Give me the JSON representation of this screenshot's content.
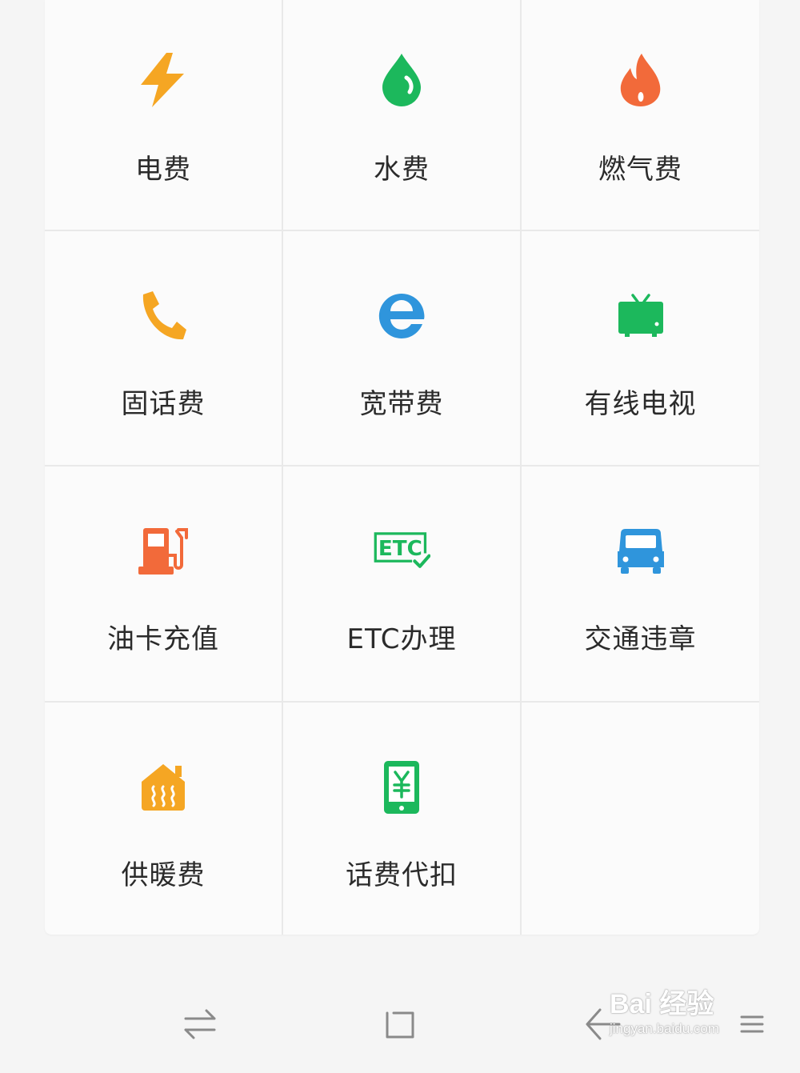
{
  "services": [
    {
      "label": "电费",
      "icon": "lightning-icon",
      "color": "#f5a623"
    },
    {
      "label": "水费",
      "icon": "water-drop-icon",
      "color": "#1cb85c"
    },
    {
      "label": "燃气费",
      "icon": "flame-icon",
      "color": "#f26a3a"
    },
    {
      "label": "固话费",
      "icon": "phone-icon",
      "color": "#f5a623"
    },
    {
      "label": "宽带费",
      "icon": "ie-browser-icon",
      "color": "#2f95dc"
    },
    {
      "label": "有线电视",
      "icon": "tv-icon",
      "color": "#1cb85c"
    },
    {
      "label": "油卡充值",
      "icon": "gas-pump-icon",
      "color": "#f26a3a"
    },
    {
      "label": "ETC办理",
      "icon": "etc-icon",
      "color": "#1cb85c"
    },
    {
      "label": "交通违章",
      "icon": "car-icon",
      "color": "#2f95dc"
    },
    {
      "label": "供暖费",
      "icon": "heating-icon",
      "color": "#f5a623"
    },
    {
      "label": "话费代扣",
      "icon": "mobile-yuan-icon",
      "color": "#1cb85c"
    }
  ],
  "navbar": {
    "switch_icon": "switch-arrows-icon",
    "home_icon": "home-square-icon",
    "back_icon": "back-arrow-icon",
    "menu_icon": "menu-icon"
  },
  "watermark": {
    "brand": "Bai 经验",
    "url": "jingyan.baidu.com"
  }
}
